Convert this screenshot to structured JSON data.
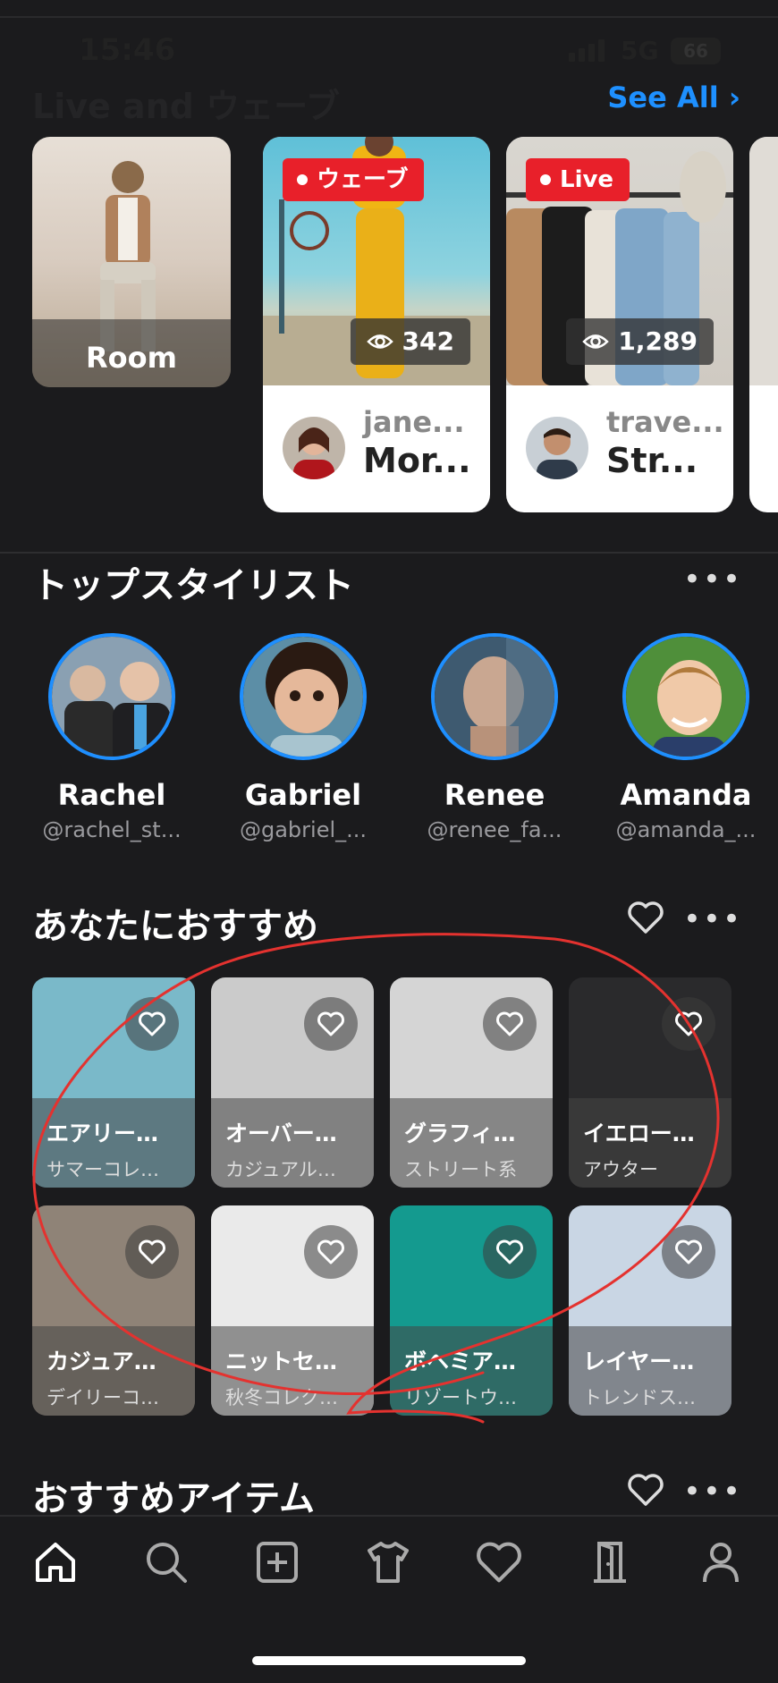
{
  "status": {
    "time": "15:46",
    "network": "5G",
    "battery": "66"
  },
  "live": {
    "title": "Live and ウェーブ",
    "see_all": "See All",
    "room_label": "Room",
    "cards": [
      {
        "badge": "ウェーブ",
        "views": "342",
        "username": "jane...",
        "title": "Mor..."
      },
      {
        "badge": "Live",
        "views": "1,289",
        "username": "trave...",
        "title": "Str..."
      }
    ]
  },
  "stylists": {
    "title": "トップスタイリスト",
    "items": [
      {
        "name": "Rachel",
        "handle": "@rachel_st..."
      },
      {
        "name": "Gabriel",
        "handle": "@gabriel_..."
      },
      {
        "name": "Renee",
        "handle": "@renee_fa..."
      },
      {
        "name": "Amanda",
        "handle": "@amanda_..."
      }
    ]
  },
  "recommend": {
    "title": "あなたにおすすめ",
    "tiles": [
      {
        "title": "エアリー…",
        "subtitle": "サマーコレ…",
        "bg": "#7ab9c9"
      },
      {
        "title": "オーバー…",
        "subtitle": "カジュアル…",
        "bg": "#cbcbcb"
      },
      {
        "title": "グラフィ…",
        "subtitle": "ストリート系",
        "bg": "#d5d5d5"
      },
      {
        "title": "イエロー…",
        "subtitle": "アウター",
        "bg": "#2a2a2c"
      },
      {
        "title": "カジュア…",
        "subtitle": "デイリーコ…",
        "bg": "#8f8377"
      },
      {
        "title": "ニットセ…",
        "subtitle": "秋冬コレク…",
        "bg": "#eaeaea"
      },
      {
        "title": "ボヘミア…",
        "subtitle": "リゾートウ…",
        "bg": "#149a8f"
      },
      {
        "title": "レイヤー…",
        "subtitle": "トレンドス…",
        "bg": "#c9d6e4"
      }
    ]
  },
  "items": {
    "title": "おすすめアイテム"
  },
  "icons": {
    "tabs": [
      "home-icon",
      "search-icon",
      "add-icon",
      "shirt-icon",
      "heart-icon",
      "door-icon",
      "profile-icon"
    ]
  },
  "colors": {
    "accent": "#1e90ff",
    "live_red": "#e8202a",
    "background": "#1b1b1d"
  }
}
